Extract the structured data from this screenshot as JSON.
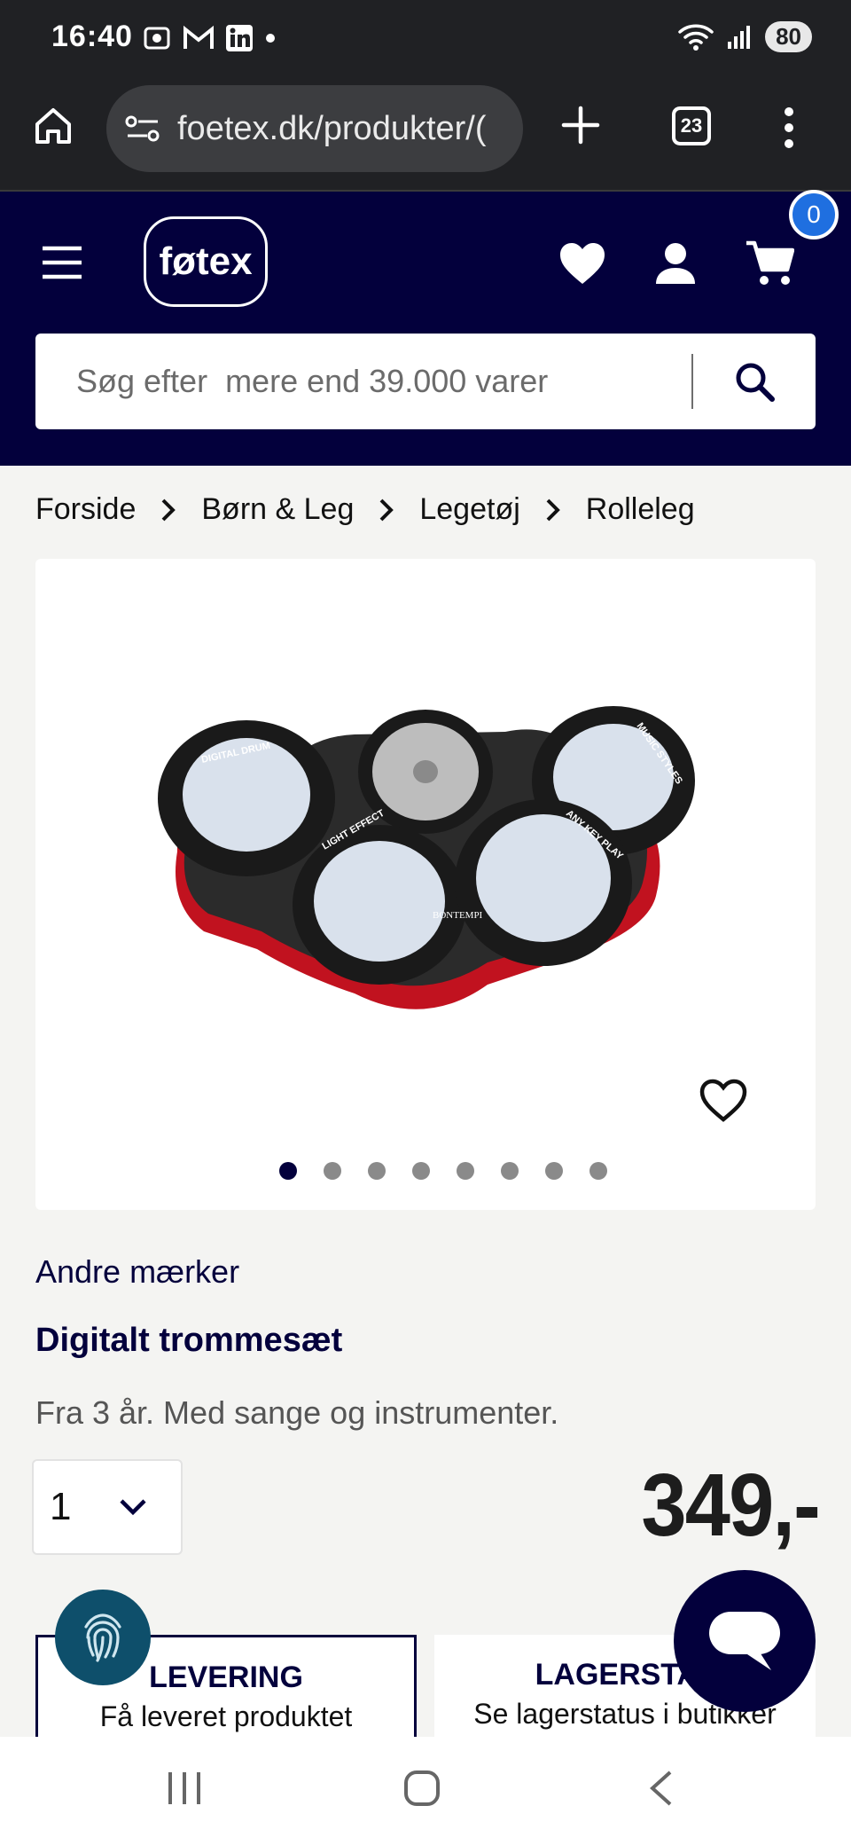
{
  "status_bar": {
    "time": "16:40",
    "battery": "80"
  },
  "browser": {
    "url": "foetex.dk/produkter/(",
    "tab_count": "23"
  },
  "header": {
    "logo": "føtex",
    "cart_count": "0",
    "search_placeholder": "Søg efter  mere end 39.000 varer"
  },
  "breadcrumb": [
    "Forside",
    "Børn & Leg",
    "Legetøj",
    "Rolleleg"
  ],
  "gallery": {
    "image_count": 8,
    "active_index": 0,
    "pad_labels": {
      "left": "DIGITAL DRUM",
      "right": "MUSIC STYLES",
      "bottom_left": "LIGHT EFFECT",
      "bottom_right": "ANY KEY PLAY",
      "brand": "BONTEMPI"
    }
  },
  "product": {
    "brand": "Andre mærker",
    "title": "Digitalt trommesæt",
    "subtitle": "Fra 3 år. Med sange og instrumenter.",
    "quantity": "1",
    "price": "349,-"
  },
  "cards": {
    "delivery_title": "LEVERING",
    "delivery_sub": "Få leveret produktet",
    "stock_title": "LAGERSTAT",
    "stock_sub": "Se lagerstatus i butikker"
  },
  "colors": {
    "brand_navy": "#03003c",
    "badge_blue": "#1f6fe0",
    "fingerprint_teal": "#0e4f6b",
    "drum_red": "#c1121f"
  }
}
